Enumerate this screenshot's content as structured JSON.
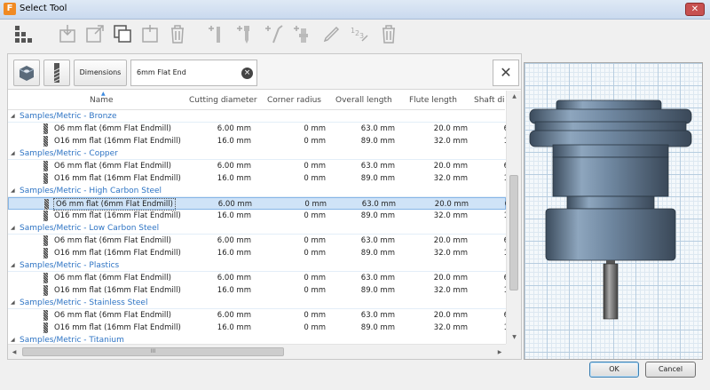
{
  "window": {
    "title": "Select Tool",
    "app_icon_letter": "F",
    "close_glyph": "✕"
  },
  "toolbar": {
    "icons": [
      "tree-view-icon",
      "import-icon",
      "export-icon",
      "copy-icon",
      "paste-icon",
      "delete-icon",
      "new-mill-icon",
      "new-drill-icon",
      "new-turning-icon",
      "new-holder-icon",
      "edit-icon",
      "renumber-icon",
      "delete-tool-icon"
    ]
  },
  "filter": {
    "dimensions_label": "Dimensions",
    "search_value": "6mm Flat End",
    "clear_glyph": "×",
    "close_glyph": "✕"
  },
  "table": {
    "sort_glyph": "▲",
    "columns": [
      "Name",
      "Cutting diameter",
      "Corner radius",
      "Overall length",
      "Flute length",
      "Shaft di"
    ],
    "groups": [
      {
        "label": "Samples/Metric - Bronze",
        "rows": [
          {
            "name": "O6 mm flat (6mm Flat Endmill)",
            "cutting": "6.00 mm",
            "corner": "0 mm",
            "overall": "63.0 mm",
            "flute": "20.0 mm",
            "shaft": "6"
          },
          {
            "name": "O16 mm flat (16mm Flat Endmill)",
            "cutting": "16.0 mm",
            "corner": "0 mm",
            "overall": "89.0 mm",
            "flute": "32.0 mm",
            "shaft": "1"
          }
        ]
      },
      {
        "label": "Samples/Metric - Copper",
        "rows": [
          {
            "name": "O6 mm flat (6mm Flat Endmill)",
            "cutting": "6.00 mm",
            "corner": "0 mm",
            "overall": "63.0 mm",
            "flute": "20.0 mm",
            "shaft": "6"
          },
          {
            "name": "O16 mm flat (16mm Flat Endmill)",
            "cutting": "16.0 mm",
            "corner": "0 mm",
            "overall": "89.0 mm",
            "flute": "32.0 mm",
            "shaft": "1"
          }
        ]
      },
      {
        "label": "Samples/Metric - High Carbon Steel",
        "rows": [
          {
            "name": "O6 mm flat (6mm Flat Endmill)",
            "cutting": "6.00 mm",
            "corner": "0 mm",
            "overall": "63.0 mm",
            "flute": "20.0 mm",
            "shaft": "6",
            "selected": true
          },
          {
            "name": "O16 mm flat (16mm Flat Endmill)",
            "cutting": "16.0 mm",
            "corner": "0 mm",
            "overall": "89.0 mm",
            "flute": "32.0 mm",
            "shaft": "1"
          }
        ]
      },
      {
        "label": "Samples/Metric - Low Carbon Steel",
        "rows": [
          {
            "name": "O6 mm flat (6mm Flat Endmill)",
            "cutting": "6.00 mm",
            "corner": "0 mm",
            "overall": "63.0 mm",
            "flute": "20.0 mm",
            "shaft": "6"
          },
          {
            "name": "O16 mm flat (16mm Flat Endmill)",
            "cutting": "16.0 mm",
            "corner": "0 mm",
            "overall": "89.0 mm",
            "flute": "32.0 mm",
            "shaft": "1"
          }
        ]
      },
      {
        "label": "Samples/Metric - Plastics",
        "rows": [
          {
            "name": "O6 mm flat (6mm Flat Endmill)",
            "cutting": "6.00 mm",
            "corner": "0 mm",
            "overall": "63.0 mm",
            "flute": "20.0 mm",
            "shaft": "6"
          },
          {
            "name": "O16 mm flat (16mm Flat Endmill)",
            "cutting": "16.0 mm",
            "corner": "0 mm",
            "overall": "89.0 mm",
            "flute": "32.0 mm",
            "shaft": "1"
          }
        ]
      },
      {
        "label": "Samples/Metric - Stainless Steel",
        "rows": [
          {
            "name": "O6 mm flat (6mm Flat Endmill)",
            "cutting": "6.00 mm",
            "corner": "0 mm",
            "overall": "63.0 mm",
            "flute": "20.0 mm",
            "shaft": "6"
          },
          {
            "name": "O16 mm flat (16mm Flat Endmill)",
            "cutting": "16.0 mm",
            "corner": "0 mm",
            "overall": "89.0 mm",
            "flute": "32.0 mm",
            "shaft": "1"
          }
        ]
      },
      {
        "label": "Samples/Metric - Titanium",
        "rows": []
      }
    ]
  },
  "scrollbars": {
    "up_glyph": "▲",
    "down_glyph": "▼",
    "left_glyph": "◀",
    "right_glyph": "▶",
    "grip_glyph": "III"
  },
  "footer": {
    "ok_label": "OK",
    "cancel_label": "Cancel"
  },
  "colors": {
    "accent": "#2e74c4",
    "selected_row": "#cfe3f7",
    "tool_body": "#6f87a0"
  }
}
